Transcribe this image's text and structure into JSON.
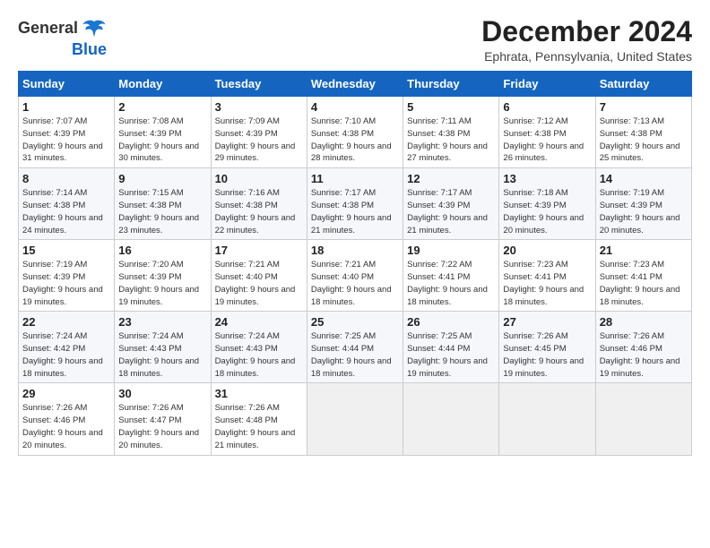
{
  "logo": {
    "general": "General",
    "blue": "Blue"
  },
  "title": "December 2024",
  "location": "Ephrata, Pennsylvania, United States",
  "days_of_week": [
    "Sunday",
    "Monday",
    "Tuesday",
    "Wednesday",
    "Thursday",
    "Friday",
    "Saturday"
  ],
  "weeks": [
    [
      {
        "day": 1,
        "sunrise": "7:07 AM",
        "sunset": "4:39 PM",
        "daylight": "9 hours and 31 minutes."
      },
      {
        "day": 2,
        "sunrise": "7:08 AM",
        "sunset": "4:39 PM",
        "daylight": "9 hours and 30 minutes."
      },
      {
        "day": 3,
        "sunrise": "7:09 AM",
        "sunset": "4:39 PM",
        "daylight": "9 hours and 29 minutes."
      },
      {
        "day": 4,
        "sunrise": "7:10 AM",
        "sunset": "4:38 PM",
        "daylight": "9 hours and 28 minutes."
      },
      {
        "day": 5,
        "sunrise": "7:11 AM",
        "sunset": "4:38 PM",
        "daylight": "9 hours and 27 minutes."
      },
      {
        "day": 6,
        "sunrise": "7:12 AM",
        "sunset": "4:38 PM",
        "daylight": "9 hours and 26 minutes."
      },
      {
        "day": 7,
        "sunrise": "7:13 AM",
        "sunset": "4:38 PM",
        "daylight": "9 hours and 25 minutes."
      }
    ],
    [
      {
        "day": 8,
        "sunrise": "7:14 AM",
        "sunset": "4:38 PM",
        "daylight": "9 hours and 24 minutes."
      },
      {
        "day": 9,
        "sunrise": "7:15 AM",
        "sunset": "4:38 PM",
        "daylight": "9 hours and 23 minutes."
      },
      {
        "day": 10,
        "sunrise": "7:16 AM",
        "sunset": "4:38 PM",
        "daylight": "9 hours and 22 minutes."
      },
      {
        "day": 11,
        "sunrise": "7:17 AM",
        "sunset": "4:38 PM",
        "daylight": "9 hours and 21 minutes."
      },
      {
        "day": 12,
        "sunrise": "7:17 AM",
        "sunset": "4:39 PM",
        "daylight": "9 hours and 21 minutes."
      },
      {
        "day": 13,
        "sunrise": "7:18 AM",
        "sunset": "4:39 PM",
        "daylight": "9 hours and 20 minutes."
      },
      {
        "day": 14,
        "sunrise": "7:19 AM",
        "sunset": "4:39 PM",
        "daylight": "9 hours and 20 minutes."
      }
    ],
    [
      {
        "day": 15,
        "sunrise": "7:19 AM",
        "sunset": "4:39 PM",
        "daylight": "9 hours and 19 minutes."
      },
      {
        "day": 16,
        "sunrise": "7:20 AM",
        "sunset": "4:39 PM",
        "daylight": "9 hours and 19 minutes."
      },
      {
        "day": 17,
        "sunrise": "7:21 AM",
        "sunset": "4:40 PM",
        "daylight": "9 hours and 19 minutes."
      },
      {
        "day": 18,
        "sunrise": "7:21 AM",
        "sunset": "4:40 PM",
        "daylight": "9 hours and 18 minutes."
      },
      {
        "day": 19,
        "sunrise": "7:22 AM",
        "sunset": "4:41 PM",
        "daylight": "9 hours and 18 minutes."
      },
      {
        "day": 20,
        "sunrise": "7:23 AM",
        "sunset": "4:41 PM",
        "daylight": "9 hours and 18 minutes."
      },
      {
        "day": 21,
        "sunrise": "7:23 AM",
        "sunset": "4:41 PM",
        "daylight": "9 hours and 18 minutes."
      }
    ],
    [
      {
        "day": 22,
        "sunrise": "7:24 AM",
        "sunset": "4:42 PM",
        "daylight": "9 hours and 18 minutes."
      },
      {
        "day": 23,
        "sunrise": "7:24 AM",
        "sunset": "4:43 PM",
        "daylight": "9 hours and 18 minutes."
      },
      {
        "day": 24,
        "sunrise": "7:24 AM",
        "sunset": "4:43 PM",
        "daylight": "9 hours and 18 minutes."
      },
      {
        "day": 25,
        "sunrise": "7:25 AM",
        "sunset": "4:44 PM",
        "daylight": "9 hours and 18 minutes."
      },
      {
        "day": 26,
        "sunrise": "7:25 AM",
        "sunset": "4:44 PM",
        "daylight": "9 hours and 19 minutes."
      },
      {
        "day": 27,
        "sunrise": "7:26 AM",
        "sunset": "4:45 PM",
        "daylight": "9 hours and 19 minutes."
      },
      {
        "day": 28,
        "sunrise": "7:26 AM",
        "sunset": "4:46 PM",
        "daylight": "9 hours and 19 minutes."
      }
    ],
    [
      {
        "day": 29,
        "sunrise": "7:26 AM",
        "sunset": "4:46 PM",
        "daylight": "9 hours and 20 minutes."
      },
      {
        "day": 30,
        "sunrise": "7:26 AM",
        "sunset": "4:47 PM",
        "daylight": "9 hours and 20 minutes."
      },
      {
        "day": 31,
        "sunrise": "7:26 AM",
        "sunset": "4:48 PM",
        "daylight": "9 hours and 21 minutes."
      },
      null,
      null,
      null,
      null
    ]
  ]
}
